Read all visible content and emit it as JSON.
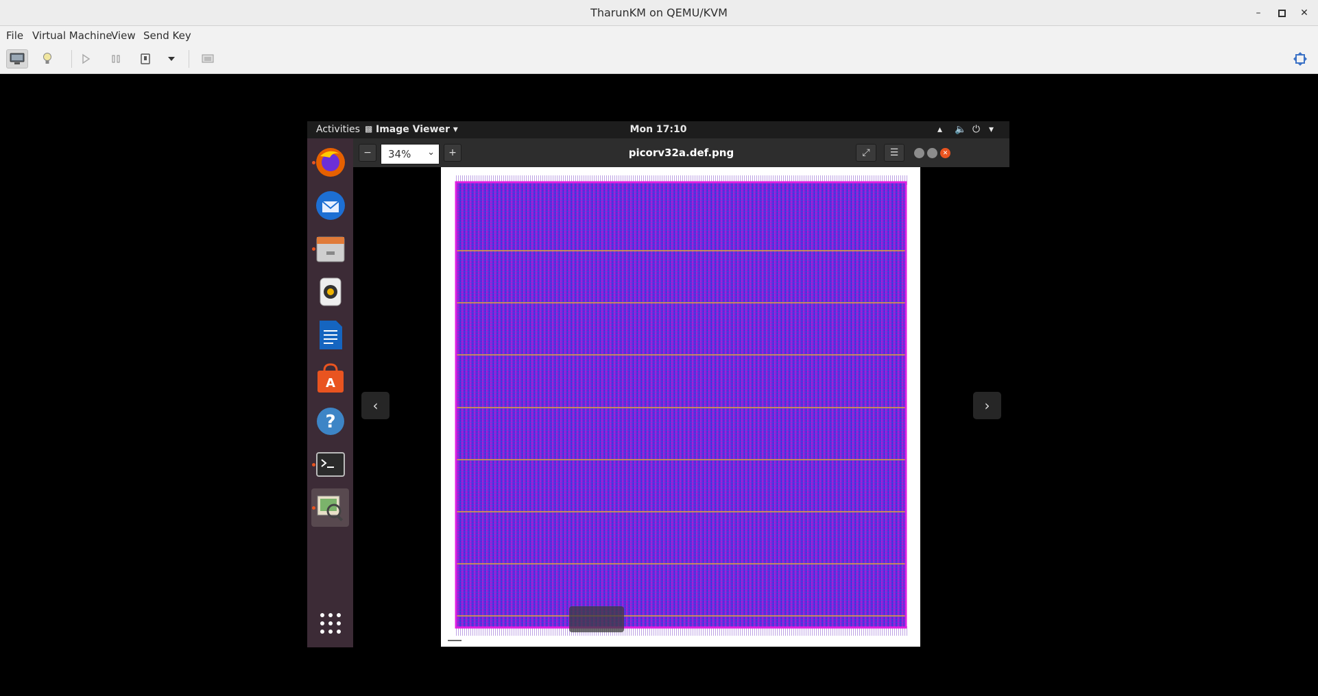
{
  "host": {
    "title": "TharunKM on QEMU/KVM",
    "menu": [
      "File",
      "Virtual Machine",
      "View",
      "Send Key"
    ]
  },
  "guest": {
    "topbar": {
      "activities": "Activities",
      "app_menu": "Image Viewer",
      "clock": "Mon 17:10"
    },
    "dock": [
      "firefox-icon",
      "thunderbird-icon",
      "files-icon",
      "rhythmbox-icon",
      "libreoffice-writer-icon",
      "ubuntu-software-icon",
      "help-icon",
      "terminal-icon",
      "image-viewer-icon",
      "show-applications-icon"
    ],
    "viewer": {
      "zoom": "34%",
      "filename": "picorv32a.def.png"
    }
  }
}
